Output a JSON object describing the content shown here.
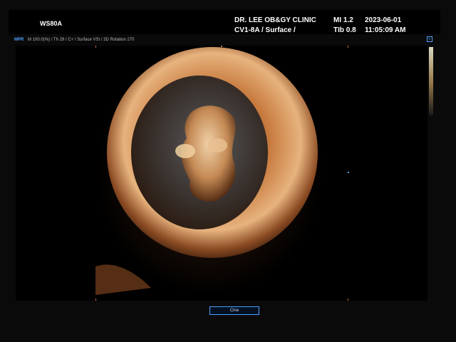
{
  "header": {
    "model": "WS80A",
    "clinic_name": "DR. LEE OB&GY CLINIC",
    "probe_mode": "CV1-8A / Surface /",
    "mi": "MI  1.2",
    "tib": "TIb 0.8",
    "date": "2023-06-01",
    "time": "11:05:09 AM"
  },
  "info_bar": {
    "mode_tag": "MPR",
    "params": "M 100.0(%) / Th 29 / C+ / Surface VSI / 3D Rotation 270"
  },
  "colors": {
    "accent": "#4ea0ff",
    "roi": "#c07050"
  },
  "controls": {
    "cine_label": "Cine"
  }
}
